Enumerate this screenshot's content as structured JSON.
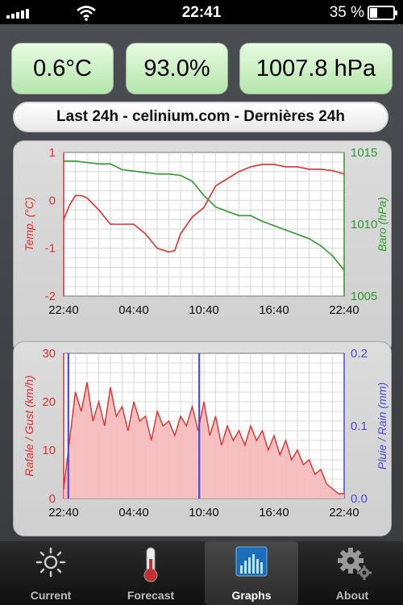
{
  "status_bar": {
    "time": "22:41",
    "battery": "35 %",
    "battery_level": 0.35
  },
  "readings": {
    "temperature": "0.6°C",
    "humidity": "93.0%",
    "pressure": "1007.8 hPa"
  },
  "title": "Last 24h - celinium.com - Dernières 24h",
  "chart_data": [
    {
      "type": "line",
      "x_ticks": [
        "22:40",
        "04:40",
        "10:40",
        "16:40",
        "22:40"
      ],
      "y_left_ticks": [
        "1",
        "0",
        "-1",
        "-2"
      ],
      "y_right_ticks": [
        "1015",
        "1010",
        "1005"
      ],
      "ylabel_left": "Temp. (°C)",
      "ylabel_right": "Baro (hPa)",
      "ylim_left": [
        -2,
        1
      ],
      "ylim_right": [
        1005,
        1015
      ],
      "x_hours_range": [
        0,
        24
      ],
      "grid": true,
      "colors": {
        "left": "#e03030",
        "right": "#2e9a2e"
      },
      "series": [
        {
          "axis": "left",
          "x": [
            0,
            0.5,
            1,
            1.5,
            2,
            3,
            4,
            5,
            6,
            7,
            8,
            9,
            9.5,
            10,
            11,
            12,
            13,
            14,
            15,
            16,
            17,
            18,
            19,
            20,
            21,
            22,
            23,
            24
          ],
          "values": [
            -0.4,
            -0.1,
            0.1,
            0.1,
            0.05,
            -0.2,
            -0.5,
            -0.5,
            -0.5,
            -0.7,
            -1.0,
            -1.08,
            -1.05,
            -0.7,
            -0.35,
            -0.15,
            0.3,
            0.45,
            0.6,
            0.7,
            0.75,
            0.75,
            0.7,
            0.7,
            0.65,
            0.65,
            0.62,
            0.55
          ]
        },
        {
          "axis": "right",
          "x": [
            0,
            1,
            2,
            3,
            4,
            5,
            6,
            7,
            8,
            9,
            10,
            11,
            12,
            13,
            14,
            15,
            16,
            17,
            18,
            19,
            20,
            21,
            22,
            23,
            24
          ],
          "values": [
            1014.4,
            1014.4,
            1014.3,
            1014.2,
            1014.2,
            1013.8,
            1013.7,
            1013.6,
            1013.5,
            1013.5,
            1013.4,
            1013.0,
            1012.0,
            1011.2,
            1010.9,
            1010.6,
            1010.6,
            1010.2,
            1009.9,
            1009.6,
            1009.3,
            1009.0,
            1008.5,
            1007.8,
            1006.8
          ]
        }
      ]
    },
    {
      "type": "area",
      "x_ticks": [
        "22:40",
        "04:40",
        "10:40",
        "16:40",
        "22:40"
      ],
      "y_left_ticks": [
        "30",
        "20",
        "10",
        "0"
      ],
      "y_right_ticks": [
        "0.2",
        "0.1",
        "0.0"
      ],
      "ylabel_left": "Rafale / Gust (km/h)",
      "ylabel_right": "Pluie / Rain (mm)",
      "ylim_left": [
        0,
        30
      ],
      "ylim_right": [
        0,
        0.2
      ],
      "x_hours_range": [
        0,
        24
      ],
      "grid": true,
      "colors": {
        "gust": "#e03030",
        "gust_fill": "#f6b9b9",
        "rain": "#4b4bd6"
      },
      "series": [
        {
          "name": "gust",
          "x": [
            0,
            0.3,
            0.6,
            1,
            1.5,
            2,
            2.5,
            3,
            3.5,
            4,
            4.5,
            5,
            5.5,
            6,
            6.5,
            7,
            7.5,
            8,
            8.5,
            9,
            9.5,
            10,
            10.5,
            11,
            11.5,
            12,
            12.5,
            13,
            13.5,
            14,
            14.5,
            15,
            15.5,
            16,
            16.5,
            17,
            17.5,
            18,
            18.5,
            19,
            19.5,
            20,
            20.5,
            21,
            21.5,
            22,
            22.5,
            23,
            23.5,
            24
          ],
          "values": [
            2,
            8,
            14,
            22,
            18,
            24,
            16,
            20,
            15,
            23,
            17,
            19,
            14,
            20,
            16,
            17,
            12,
            18,
            15,
            16,
            13,
            17,
            15,
            19,
            14,
            20,
            13,
            17,
            11,
            15,
            12,
            14,
            11,
            15,
            12,
            14,
            10,
            13,
            9,
            12,
            8,
            10,
            7,
            8,
            5,
            6,
            3,
            2,
            1,
            1
          ]
        },
        {
          "name": "rain",
          "x": [
            0.4,
            11.6
          ],
          "values": [
            0.2,
            0.2
          ]
        }
      ]
    }
  ],
  "tabs": [
    {
      "label": "Current",
      "icon": "sun-icon"
    },
    {
      "label": "Forecast",
      "icon": "thermometer-icon"
    },
    {
      "label": "Graphs",
      "icon": "bar-chart-icon"
    },
    {
      "label": "About",
      "icon": "gears-icon"
    }
  ]
}
